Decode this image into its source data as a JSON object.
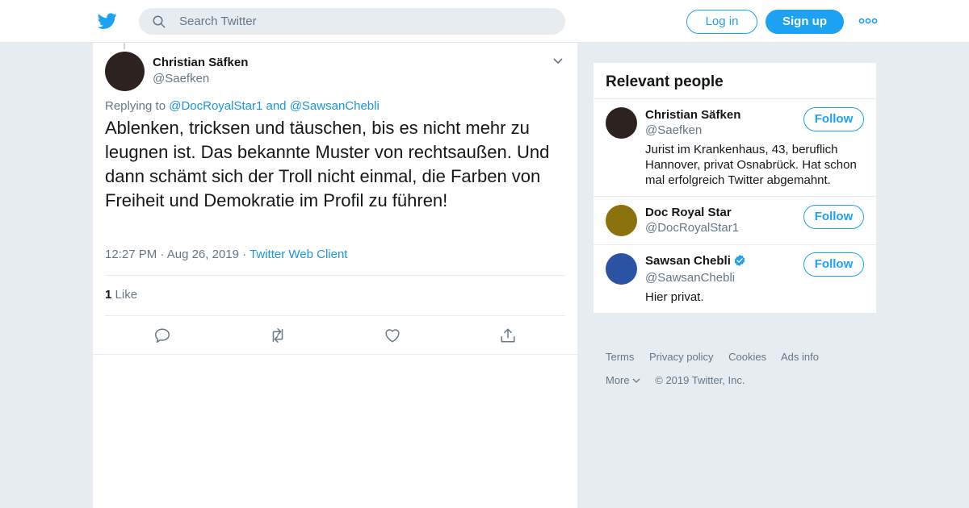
{
  "header": {
    "search_placeholder": "Search Twitter",
    "login_label": "Log in",
    "signup_label": "Sign up",
    "brand_color": "#1da1f2"
  },
  "tweet": {
    "author_name": "Christian Säfken",
    "author_handle": "@Saefken",
    "replying_prefix": "Replying to",
    "reply_to_1": "@DocRoyalStar1",
    "reply_and": "and",
    "reply_to_2": "@SawsanChebli",
    "text": "Ablenken, tricksen und täuschen, bis es nicht mehr zu leugnen ist. Das bekannte Muster von rechtsaußen. Und dann schämt sich der Troll nicht einmal, die Farben von Freiheit und Demokratie im Profil zu führen!",
    "time": "12:27 PM",
    "date": "Aug 26, 2019",
    "client": "Twitter Web Client",
    "like_count": "1",
    "like_label": "Like",
    "actions": [
      "reply-icon",
      "retweet-icon",
      "like-icon",
      "share-icon"
    ]
  },
  "relevant_people": {
    "title": "Relevant people",
    "follow_label": "Follow",
    "people": [
      {
        "name": "Christian Säfken",
        "handle": "@Saefken",
        "bio": "Jurist im Krankenhaus, 43, beruflich Hannover, privat Osnabrück. Hat schon mal erfolgreich Twitter abgemahnt.",
        "avatar_color": "#2d221f",
        "verified": false
      },
      {
        "name": "Doc Royal Star",
        "handle": "@DocRoyalStar1",
        "bio": "",
        "avatar_color": "#8c720d",
        "verified": false
      },
      {
        "name": "Sawsan Chebli",
        "handle": "@SawsanChebli",
        "bio": "Hier privat.",
        "avatar_color": "#2a53a3",
        "verified": true
      }
    ]
  },
  "footer": {
    "links": [
      "Terms",
      "Privacy policy",
      "Cookies",
      "Ads info"
    ],
    "more_label": "More",
    "copyright": "© 2019 Twitter, Inc."
  }
}
